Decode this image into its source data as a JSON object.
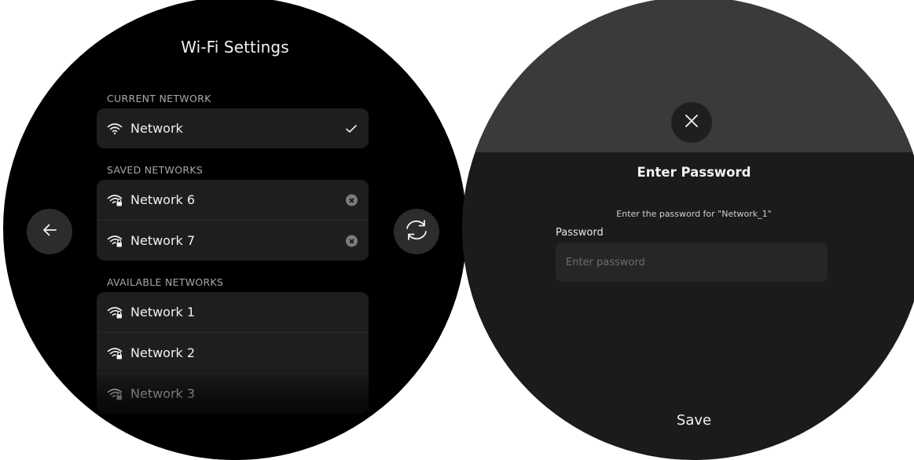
{
  "wifi_settings": {
    "title": "Wi-Fi Settings",
    "current_section_label": "CURRENT NETWORK",
    "current_network": {
      "name": "Network",
      "icon": "wifi-icon",
      "status_icon": "checkmark-icon"
    },
    "saved_section_label": "SAVED NETWORKS",
    "saved_networks": [
      {
        "name": "Network 6",
        "icon": "wifi-lock-icon",
        "action_icon": "remove-icon"
      },
      {
        "name": "Network 7",
        "icon": "wifi-lock-icon",
        "action_icon": "remove-icon"
      }
    ],
    "available_section_label": "AVAILABLE NETWORKS",
    "available_networks": [
      {
        "name": "Network 1",
        "icon": "wifi-lock-icon"
      },
      {
        "name": "Network 2",
        "icon": "wifi-lock-icon"
      },
      {
        "name": "Network 3",
        "icon": "wifi-lock-icon"
      }
    ],
    "back_icon": "arrow-left-icon",
    "refresh_icon": "refresh-icon"
  },
  "password_dialog": {
    "close_icon": "close-icon",
    "title": "Enter Password",
    "subtitle": "Enter the password for \"Network_1\"",
    "field_label": "Password",
    "field_placeholder": "Enter password",
    "field_value": "",
    "save_label": "Save"
  },
  "colors": {
    "background": "#000000",
    "card": "#1e1e1e",
    "button": "#2c2c2c",
    "dialog_header": "#3a3a3a",
    "dialog_body": "#1b1b1b",
    "text_primary": "#f1f1f1",
    "text_secondary": "#a8a8a8"
  }
}
